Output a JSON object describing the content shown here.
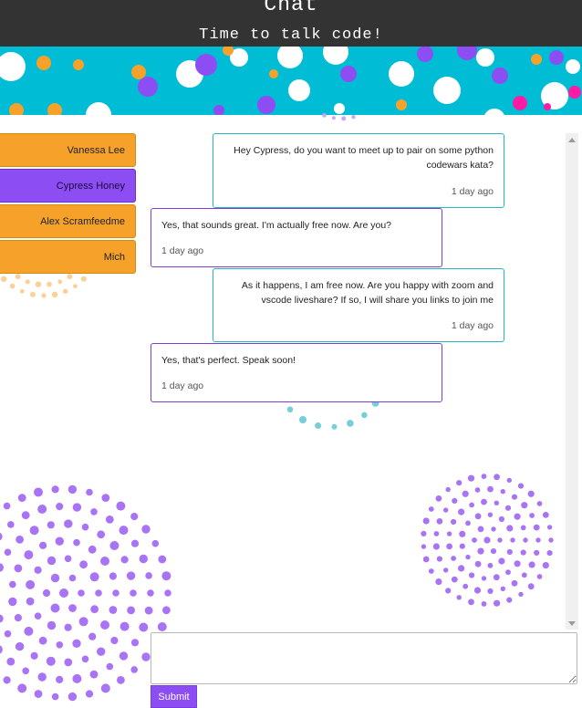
{
  "header": {
    "title": "Chat",
    "subtitle": "Time to talk code!"
  },
  "colors": {
    "header_bg": "#333333",
    "banner_bg": "#00bcd4",
    "orange": "#f6a22a",
    "purple": "#8c4df2",
    "teal_border": "#25b7c6"
  },
  "contacts": [
    {
      "name": "Vanessa Lee",
      "active": false
    },
    {
      "name": "Cypress Honey",
      "active": true
    },
    {
      "name": "Alex Scramfeedme",
      "active": false
    },
    {
      "name": "Mich",
      "active": false
    }
  ],
  "messages": [
    {
      "direction": "sent",
      "text": "Hey Cypress, do you want to meet up to pair on some python codewars kata?",
      "time": "1 day ago"
    },
    {
      "direction": "received",
      "text": "Yes, that sounds great. I'm actually free now. Are you?",
      "time": "1 day ago"
    },
    {
      "direction": "sent",
      "text": "As it happens, I am free now. Are you happy with zoom and vscode liveshare? If so, I will share you links to join me",
      "time": "1 day ago"
    },
    {
      "direction": "received",
      "text": "Yes, that's perfect. Speak soon!",
      "time": "1 day ago"
    }
  ],
  "composer": {
    "placeholder": "",
    "submit_label": "Submit"
  }
}
